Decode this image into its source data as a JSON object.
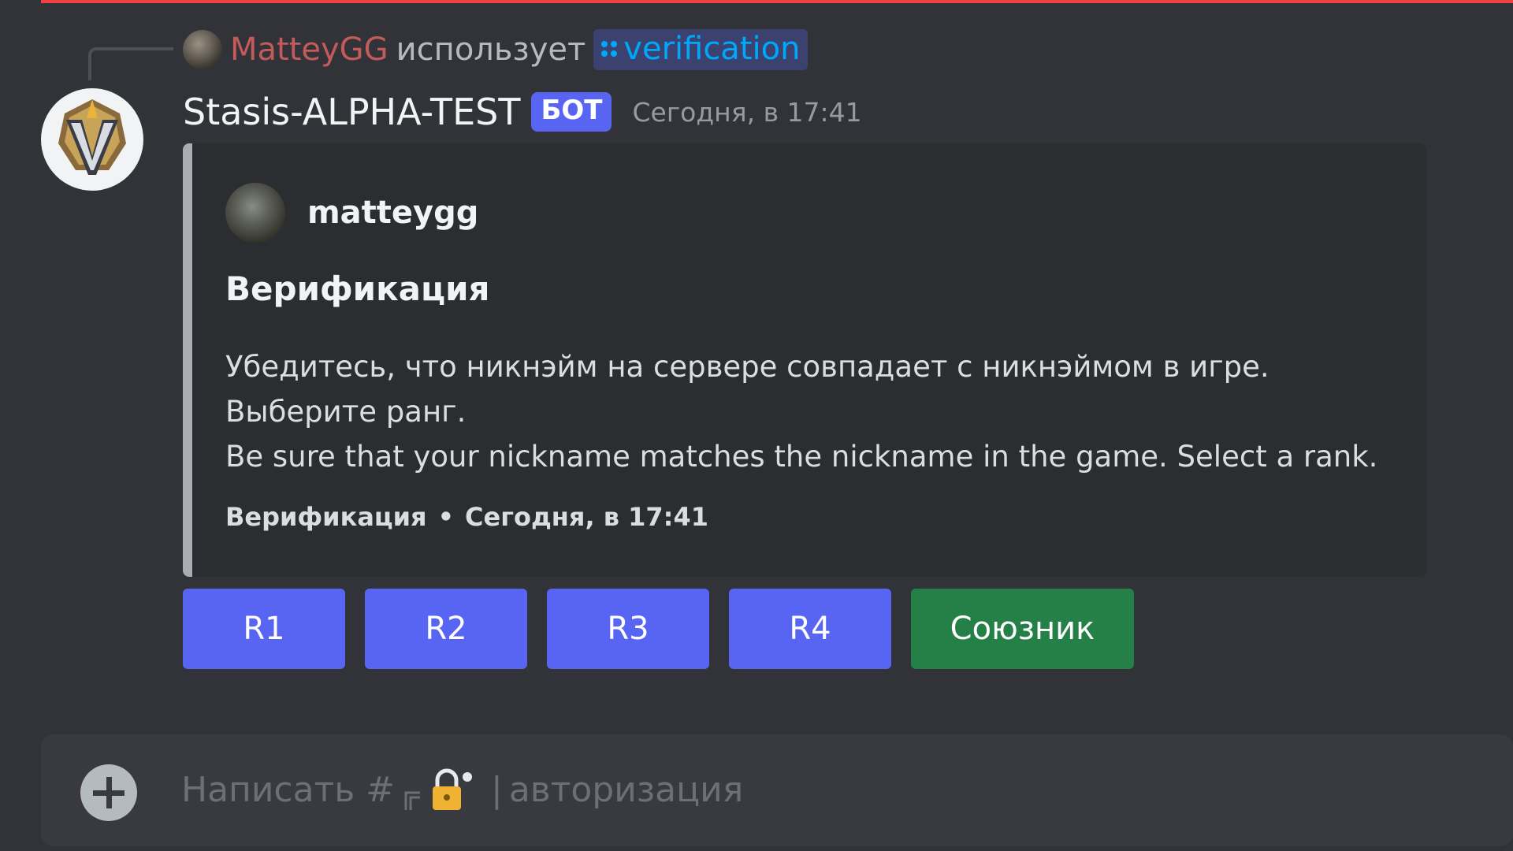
{
  "reply": {
    "user": "MatteyGG",
    "verb": "использует",
    "command": "verification"
  },
  "message": {
    "bot_name": "Stasis-ALPHA-TEST",
    "bot_tag": "БОТ",
    "timestamp": "Сегодня, в 17:41"
  },
  "embed": {
    "author": "matteygg",
    "title": "Верификация",
    "description": [
      "Убедитесь, что никнэйм на сервере совпадает с никнэймом в игре.",
      "Выберите ранг.",
      "Be sure that your nickname matches the nickname in the game. Select a rank."
    ],
    "footer_text": "Верификация",
    "footer_separator": "•",
    "footer_time": "Сегодня, в 17:41",
    "accent_color": "#aaaeb4"
  },
  "buttons": [
    {
      "label": "R1",
      "style": "primary",
      "color": "#5865f2"
    },
    {
      "label": "R2",
      "style": "primary",
      "color": "#5865f2"
    },
    {
      "label": "R3",
      "style": "primary",
      "color": "#5865f2"
    },
    {
      "label": "R4",
      "style": "primary",
      "color": "#5865f2"
    },
    {
      "label": "Союзник",
      "style": "success",
      "color": "#248046"
    }
  ],
  "input": {
    "placeholder_prefix": "Написать #",
    "separator": "|",
    "channel_name": "авторизация",
    "icons": [
      "plus-icon",
      "thread-icon",
      "lock-icon"
    ]
  },
  "colors": {
    "background": "#313338",
    "embed_background": "#2b2d31",
    "mention_color": "#00a8fc",
    "top_bar": "#f23f43"
  }
}
